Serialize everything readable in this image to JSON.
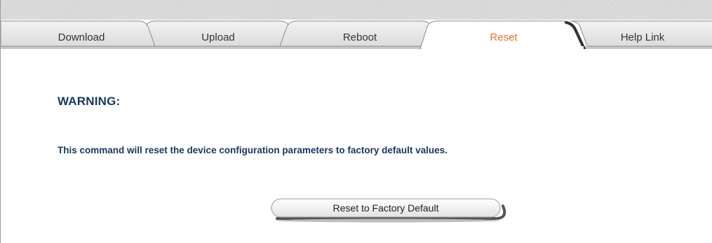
{
  "tabs": [
    {
      "label": "Download",
      "active": false
    },
    {
      "label": "Upload",
      "active": false
    },
    {
      "label": "Reboot",
      "active": false
    },
    {
      "label": "Reset",
      "active": true
    },
    {
      "label": "Help Link",
      "active": false
    }
  ],
  "content": {
    "warning_title": "WARNING:",
    "message": "This command will reset the device configuration parameters to factory default values.",
    "reset_button_label": "Reset to Factory Default"
  },
  "colors": {
    "active_tab_text": "#e8742a",
    "inactive_tab_fill": "#e6e6e6",
    "active_tab_fill": "#ffffff",
    "text_navy": "#17375e"
  }
}
